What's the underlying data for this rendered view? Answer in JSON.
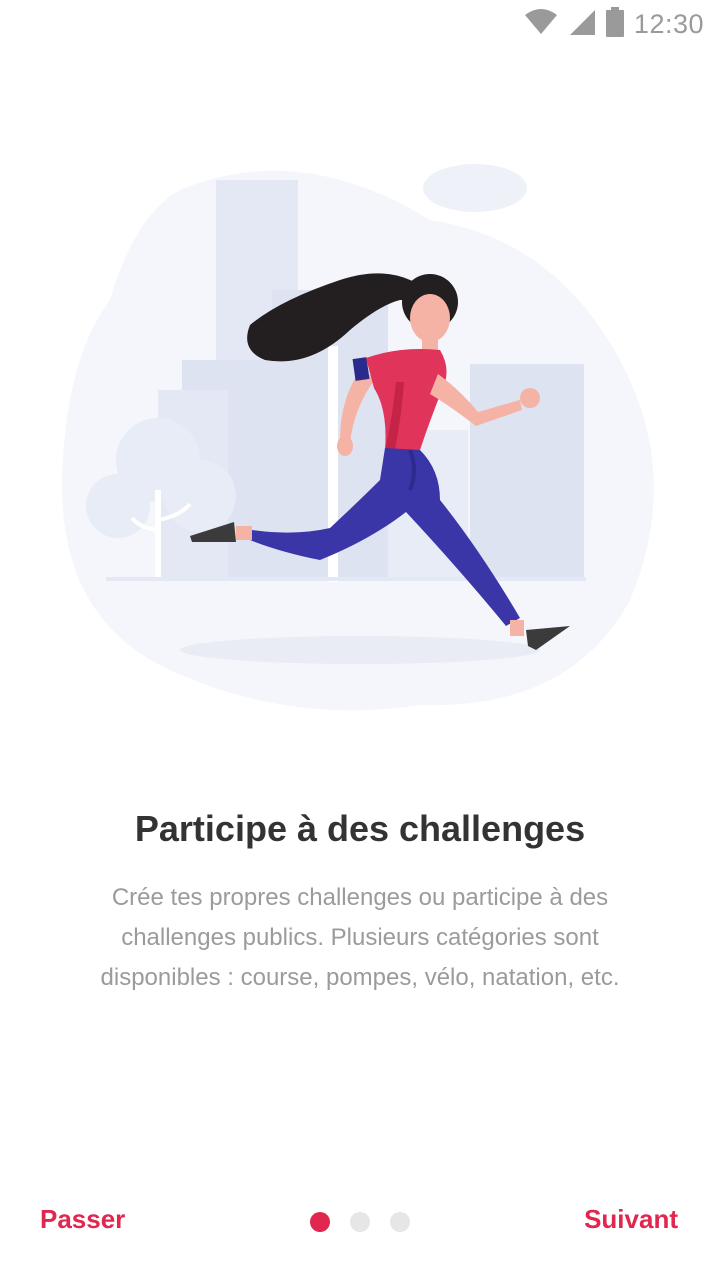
{
  "status_bar": {
    "time": "12:30",
    "icons": [
      "wifi-icon",
      "cell-signal-icon",
      "battery-icon"
    ]
  },
  "illustration": {
    "name": "running-woman-illustration"
  },
  "onboarding": {
    "title": "Participe à des challenges",
    "description": "Crée tes propres challenges ou participe à des challenges publics. Plusieurs catégories sont disponibles : course, pompes, vélo, natation, etc.",
    "page_count": 3,
    "current_page": 1
  },
  "nav": {
    "skip_label": "Passer",
    "next_label": "Suivant"
  },
  "colors": {
    "accent": "#e1264f",
    "title": "#333333",
    "body": "#9b9b9b",
    "dot_inactive": "#e6e6e6",
    "shirt": "#e0345a",
    "pants": "#3b36a8",
    "skin": "#f5a99a",
    "hair": "#231f20",
    "background_shape": "#f4f6fb",
    "buildings": "#dde3f1"
  }
}
